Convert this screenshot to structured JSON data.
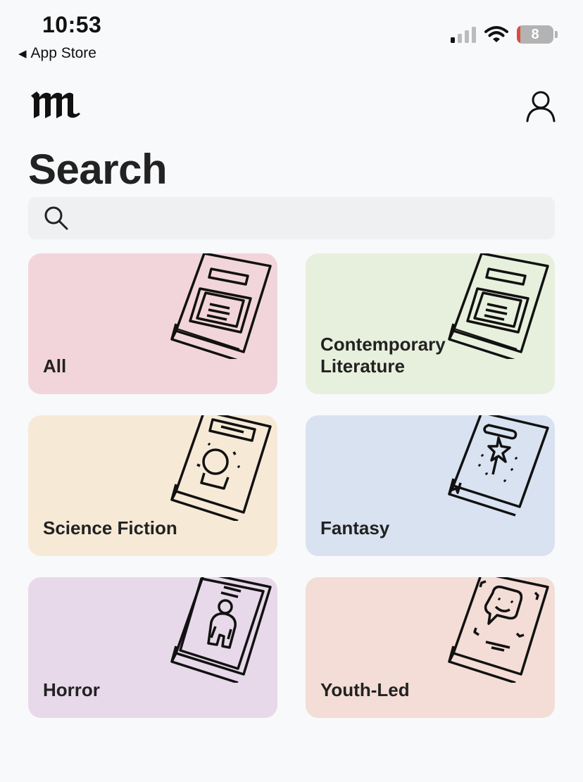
{
  "status_bar": {
    "time": "10:53",
    "back_app": "App Store",
    "battery": "8"
  },
  "header": {
    "title": "Search"
  },
  "search": {
    "placeholder": "",
    "value": ""
  },
  "categories": [
    {
      "label": "All",
      "color": "#f2d5da",
      "icon": "book-document-icon"
    },
    {
      "label": "Contemporary Literature",
      "color": "#e7f0dc",
      "icon": "book-document-icon"
    },
    {
      "label": "Science Fiction",
      "color": "#f6ead7",
      "icon": "book-crystal-ball-icon"
    },
    {
      "label": "Fantasy",
      "color": "#d9e2f1",
      "icon": "book-magic-wand-icon"
    },
    {
      "label": "Horror",
      "color": "#e7d9ea",
      "icon": "book-figure-icon"
    },
    {
      "label": "Youth-Led",
      "color": "#f3ddd6",
      "icon": "book-speech-bubble-icon"
    }
  ]
}
